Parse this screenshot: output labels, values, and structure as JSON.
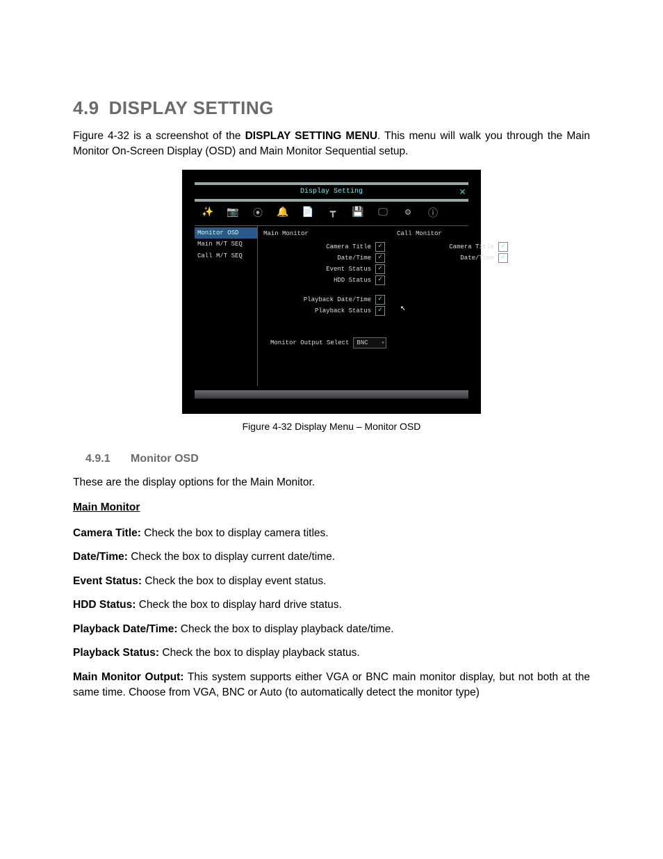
{
  "heading": {
    "number": "4.9",
    "title": "DISPLAY SETTING"
  },
  "intro": {
    "prefix": "Figure 4-32 is a screenshot of the ",
    "bold": "DISPLAY SETTING MENU",
    "suffix": ". This menu will walk you through the Main Monitor On-Screen Display (OSD) and Main Monitor Sequential setup."
  },
  "screenshot": {
    "window_title": "Display Setting",
    "close": "✕",
    "toolbar_icons": [
      {
        "name": "wizard-icon",
        "glyph": "✨"
      },
      {
        "name": "camera-icon",
        "glyph": "📷"
      },
      {
        "name": "record-icon",
        "glyph": "⦿"
      },
      {
        "name": "alarm-icon",
        "glyph": "🔔"
      },
      {
        "name": "file-icon",
        "glyph": "📄"
      },
      {
        "name": "network-icon",
        "glyph": "┳"
      },
      {
        "name": "drive-icon",
        "glyph": "💾"
      },
      {
        "name": "display-icon",
        "glyph": "🖵"
      },
      {
        "name": "system-icon",
        "glyph": "⚙"
      },
      {
        "name": "info-icon",
        "glyph": "ⓘ"
      }
    ],
    "sidebar": [
      {
        "label": "Monitor OSD",
        "active": true
      },
      {
        "label": "Main M/T SEQ",
        "active": false
      },
      {
        "label": "Call M/T SEQ",
        "active": false
      }
    ],
    "main_header": "Main Monitor",
    "call_header": "Call Monitor",
    "main_rows": [
      "Camera Title",
      "Date/Time",
      "Event Status",
      "HDD Status"
    ],
    "main_rows2": [
      "Playback Date/Time",
      "Playback Status"
    ],
    "call_rows": [
      "Camera Title",
      "Date/Time"
    ],
    "select_label": "Monitor Output Select",
    "select_value": "BNC",
    "check": "✓"
  },
  "caption": "Figure 4-32 Display Menu – Monitor OSD",
  "sub": {
    "number": "4.9.1",
    "title": "Monitor OSD"
  },
  "sub_intro": "These are the display options for the Main Monitor.",
  "group_header": "Main Monitor",
  "defs": [
    {
      "term": "Camera Title:",
      "text": " Check the box to display camera titles."
    },
    {
      "term": "Date/Time:",
      "text": " Check the box to display current date/time."
    },
    {
      "term": "Event Status:",
      "text": " Check the box to display event status."
    },
    {
      "term": "HDD Status:",
      "text": " Check the box to display hard drive status."
    },
    {
      "term": "Playback Date/Time:",
      "text": " Check the box to display playback date/time."
    },
    {
      "term": "Playback Status:",
      "text": " Check the box to display playback status."
    },
    {
      "term": "Main Monitor Output:",
      "text": "  This system supports either VGA or BNC main monitor display, but not both at the same time. Choose from VGA, BNC or Auto (to automatically detect the monitor type)"
    }
  ]
}
